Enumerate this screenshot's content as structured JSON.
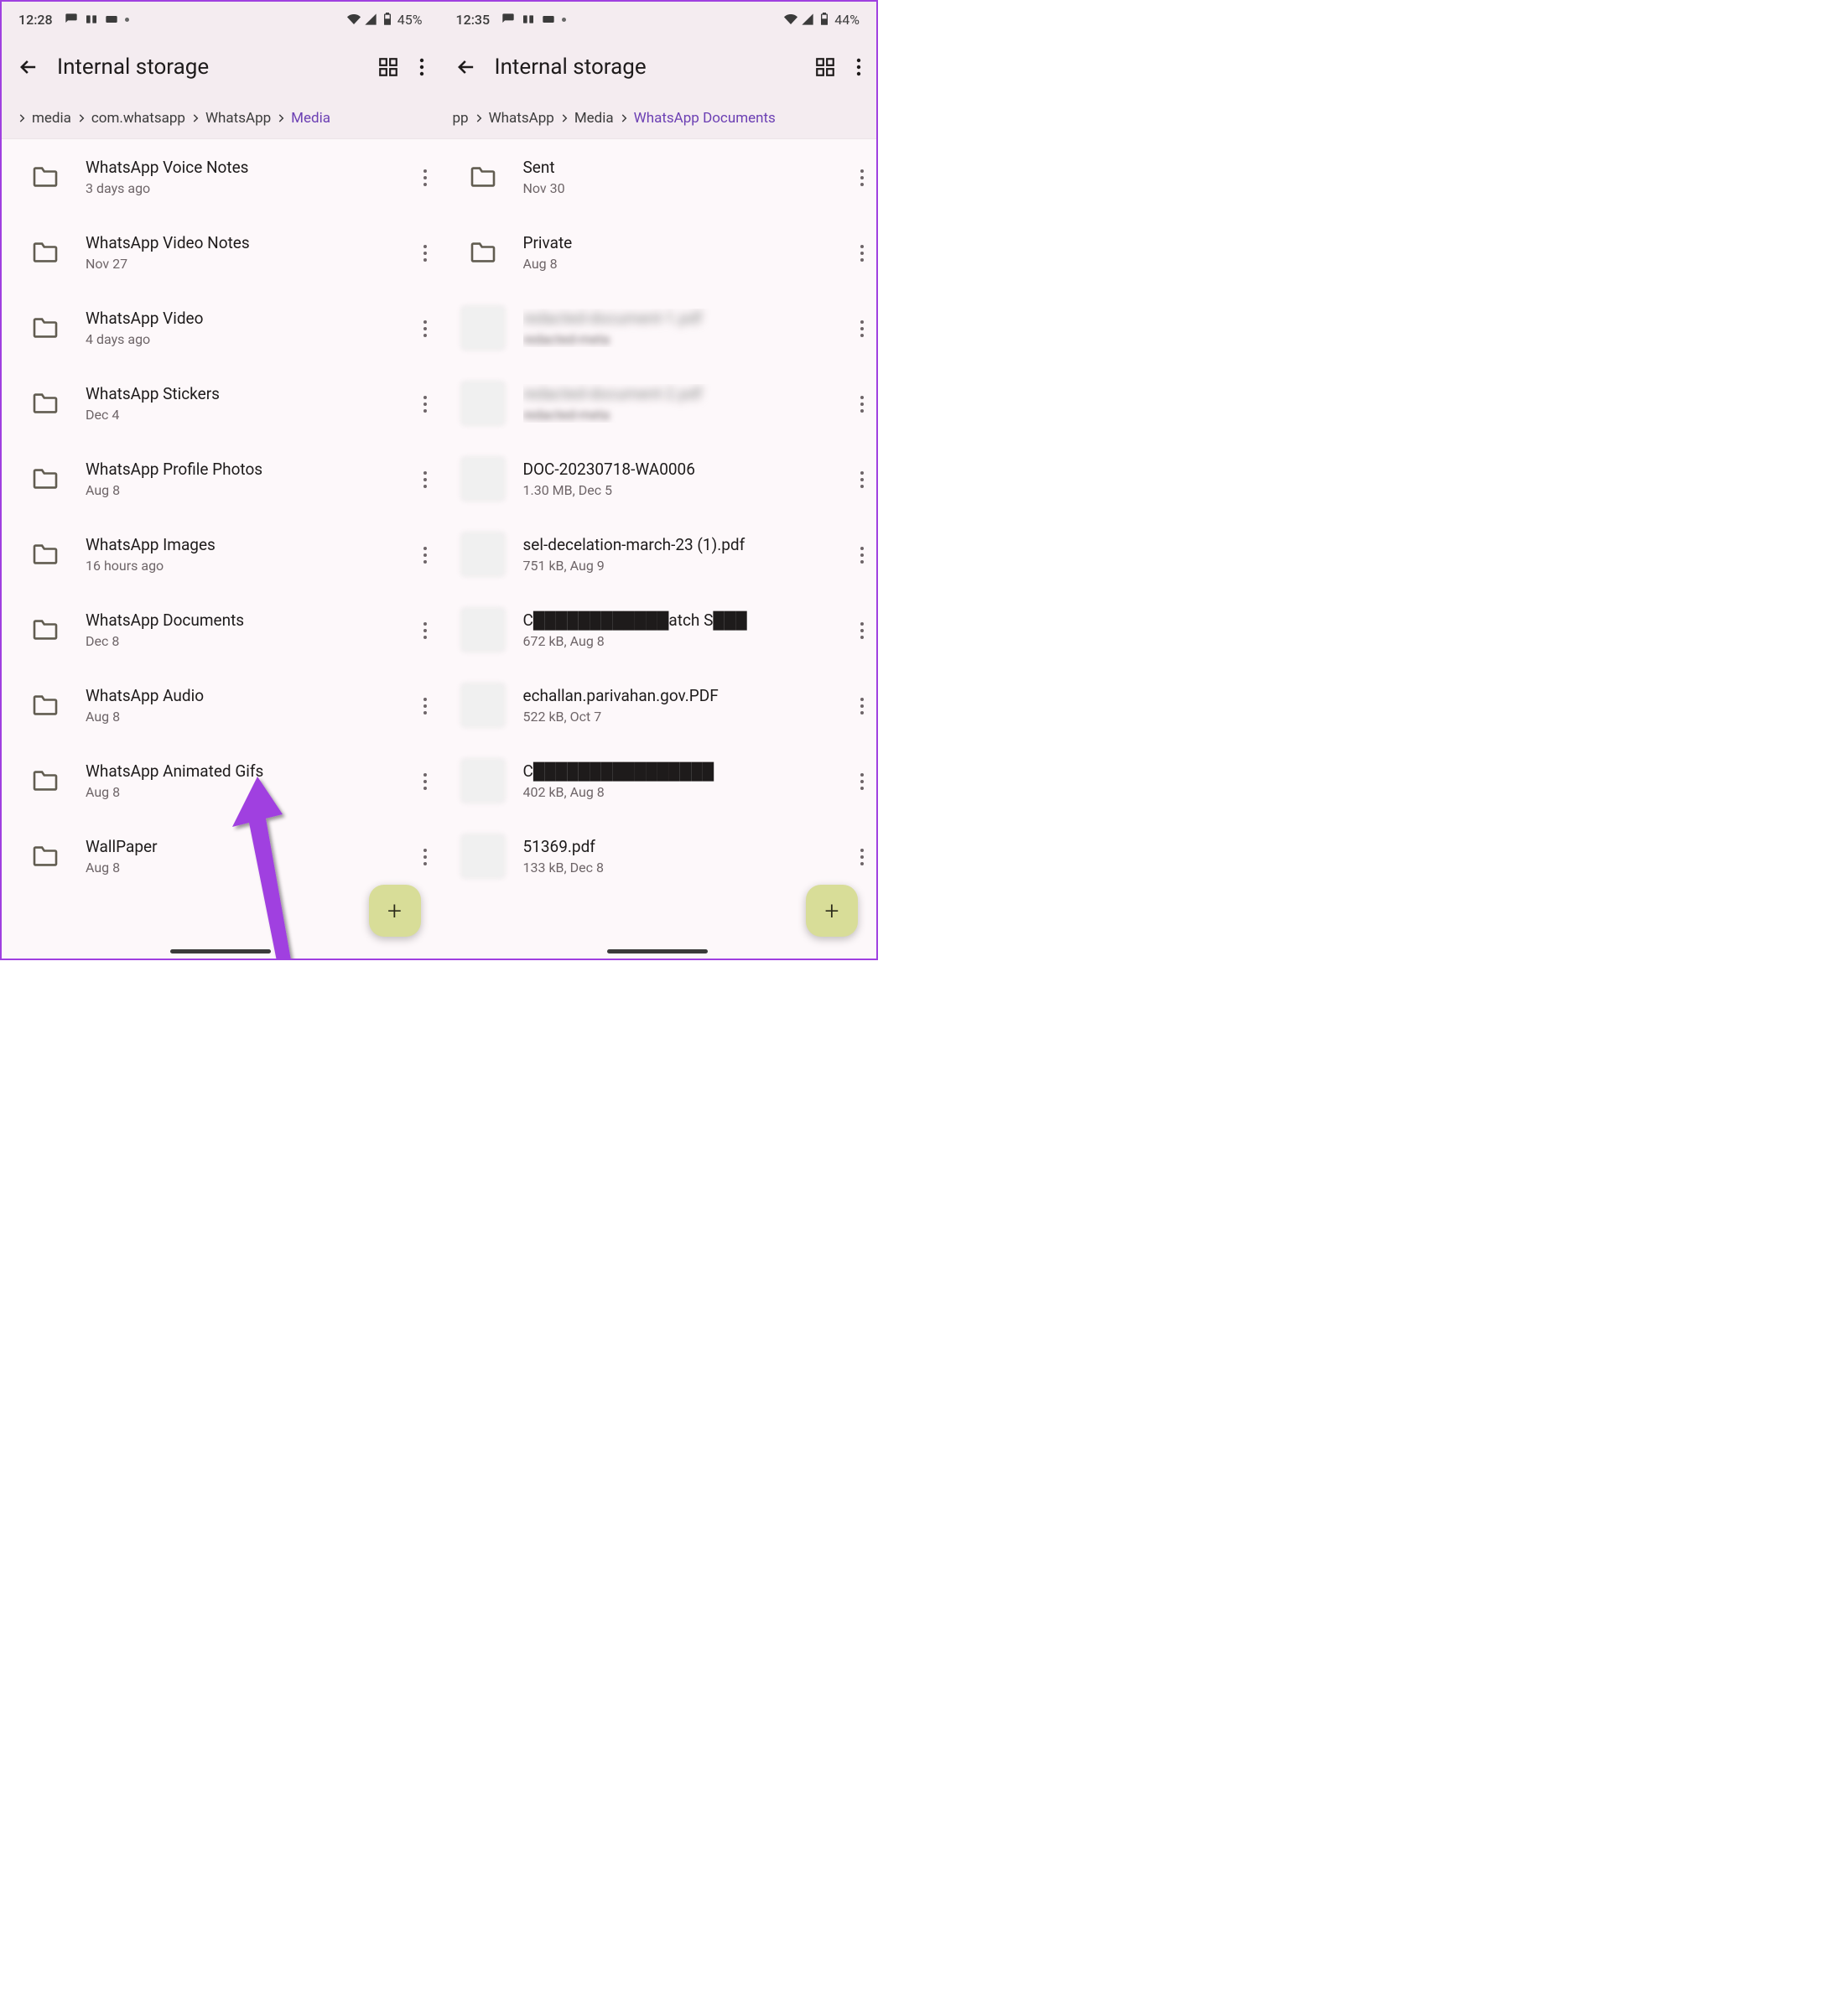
{
  "left": {
    "status": {
      "time": "12:28",
      "battery": "45%"
    },
    "title": "Internal storage",
    "breadcrumb": [
      {
        "label": "media",
        "active": false,
        "leadingSep": true
      },
      {
        "label": "com.whatsapp",
        "active": false,
        "leadingSep": true
      },
      {
        "label": "WhatsApp",
        "active": false,
        "leadingSep": true
      },
      {
        "label": "Media",
        "active": true,
        "leadingSep": true
      }
    ],
    "items": [
      {
        "type": "folder",
        "name": "WhatsApp Voice Notes",
        "meta": "3 days ago"
      },
      {
        "type": "folder",
        "name": "WhatsApp Video Notes",
        "meta": "Nov 27"
      },
      {
        "type": "folder",
        "name": "WhatsApp Video",
        "meta": "4 days ago"
      },
      {
        "type": "folder",
        "name": "WhatsApp Stickers",
        "meta": "Dec 4"
      },
      {
        "type": "folder",
        "name": "WhatsApp Profile Photos",
        "meta": "Aug 8"
      },
      {
        "type": "folder",
        "name": "WhatsApp Images",
        "meta": "16 hours ago"
      },
      {
        "type": "folder",
        "name": "WhatsApp Documents",
        "meta": "Dec 8"
      },
      {
        "type": "folder",
        "name": "WhatsApp Audio",
        "meta": "Aug 8"
      },
      {
        "type": "folder",
        "name": "WhatsApp Animated Gifs",
        "meta": "Aug 8"
      },
      {
        "type": "folder",
        "name": "WallPaper",
        "meta": "Aug 8"
      }
    ]
  },
  "right": {
    "status": {
      "time": "12:35",
      "battery": "44%"
    },
    "title": "Internal storage",
    "breadcrumb": [
      {
        "label": "pp",
        "active": false,
        "leadingSep": false
      },
      {
        "label": "WhatsApp",
        "active": false,
        "leadingSep": true
      },
      {
        "label": "Media",
        "active": false,
        "leadingSep": true
      },
      {
        "label": "WhatsApp Documents",
        "active": true,
        "leadingSep": true
      }
    ],
    "items": [
      {
        "type": "folder",
        "name": "Sent",
        "meta": "Nov 30"
      },
      {
        "type": "folder",
        "name": "Private",
        "meta": "Aug 8"
      },
      {
        "type": "thumb",
        "name": "redacted-document-1.pdf",
        "meta": "redacted-meta",
        "blurred": true
      },
      {
        "type": "thumb",
        "name": "redacted-document-2.pdf",
        "meta": "redacted-meta",
        "blurred": true
      },
      {
        "type": "thumb",
        "name": "DOC-20230718-WA0006",
        "meta": "1.30 MB, Dec 5"
      },
      {
        "type": "thumb",
        "name": "sel-decelation-march-23 (1).pdf",
        "meta": "751 kB, Aug 9"
      },
      {
        "type": "thumb",
        "name": "C████████████atch S███",
        "meta": "672 kB, Aug 8",
        "partialBlur": true
      },
      {
        "type": "thumb",
        "name": "echallan.parivahan.gov.PDF",
        "meta": "522 kB, Oct 7"
      },
      {
        "type": "thumb",
        "name": "C████████████████",
        "meta": "402 kB, Aug 8",
        "partialBlur": true
      },
      {
        "type": "thumb",
        "name": "51369.pdf",
        "meta": "133 kB, Dec 8"
      }
    ]
  }
}
